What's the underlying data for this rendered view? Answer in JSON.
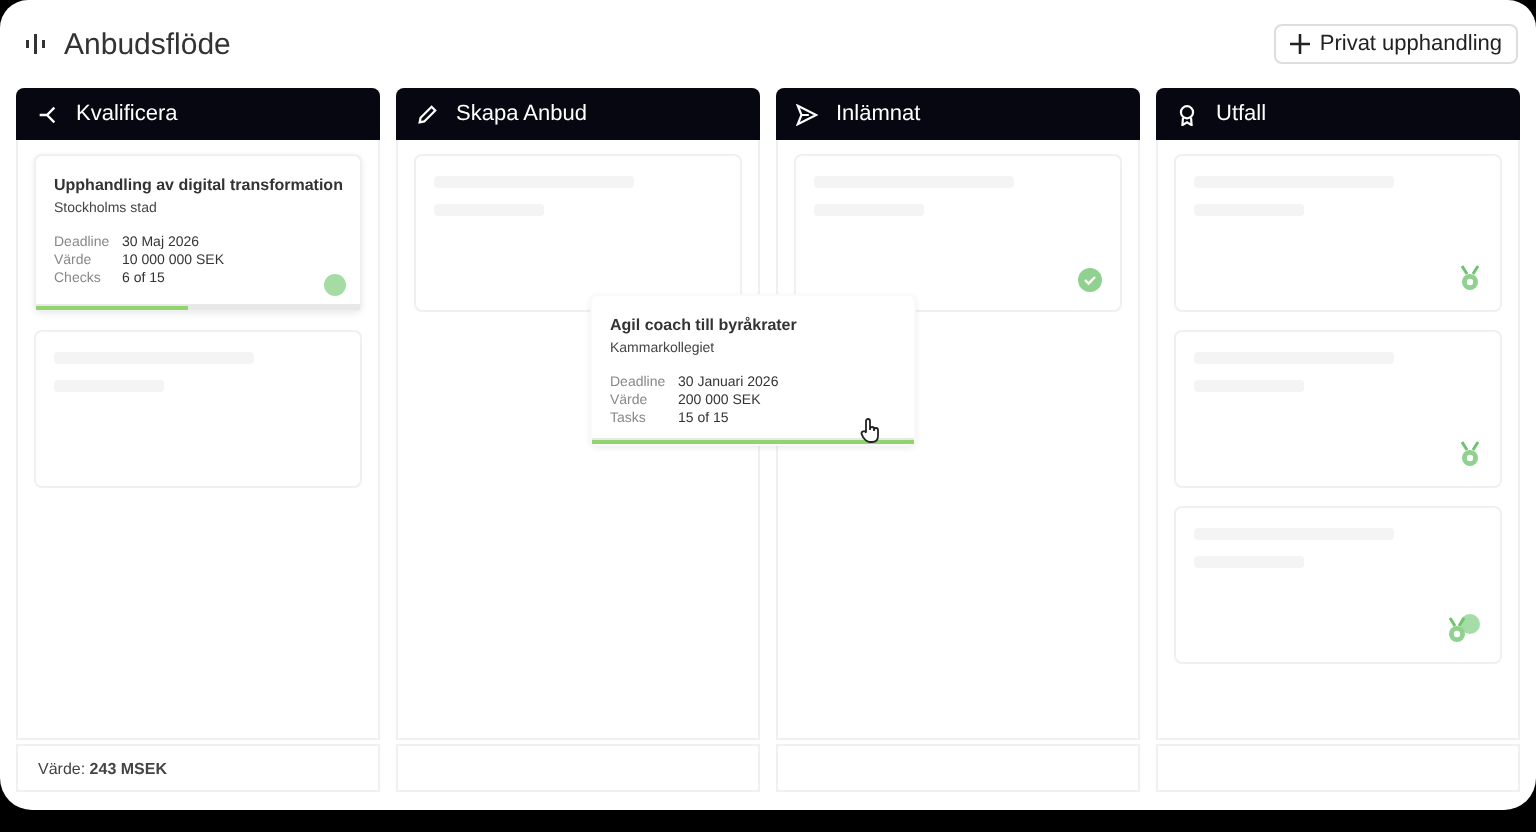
{
  "header": {
    "title": "Anbudsflöde",
    "button": "Privat upphandling"
  },
  "columns": [
    {
      "label": "Kvalificera",
      "cards": [
        {
          "kind": "deal",
          "title": "Upphandling av digital transformation",
          "org": "Stockholms stad",
          "fields": [
            {
              "label": "Deadline",
              "value": "30 Maj 2026"
            },
            {
              "label": "Värde",
              "value": "10 000 000 SEK"
            },
            {
              "label": "Checks",
              "value": "6 of 15"
            }
          ],
          "level": 0.47
        },
        {
          "kind": "skeleton"
        }
      ],
      "footer": "Värde: **243 MSEK**"
    },
    {
      "label": "Skapa Anbud",
      "cards": [
        {
          "kind": "skeleton"
        }
      ]
    },
    {
      "label": "Inlämnat",
      "cards": [
        {
          "kind": "submitted"
        }
      ]
    },
    {
      "label": "Utfall",
      "cards": [
        {
          "kind": "won"
        },
        {
          "kind": "won"
        },
        {
          "kind": "awarded"
        }
      ]
    }
  ],
  "dragged": {
    "title": "Agil coach till byråkrater",
    "org": "Kammarkollegiet",
    "fields": [
      {
        "label": "Deadline",
        "value": "30 Januari 2026"
      },
      {
        "label": "Värde",
        "value": "200 000 SEK"
      },
      {
        "label": "Tasks",
        "value": "15 of 15"
      }
    ],
    "level": 1
  }
}
